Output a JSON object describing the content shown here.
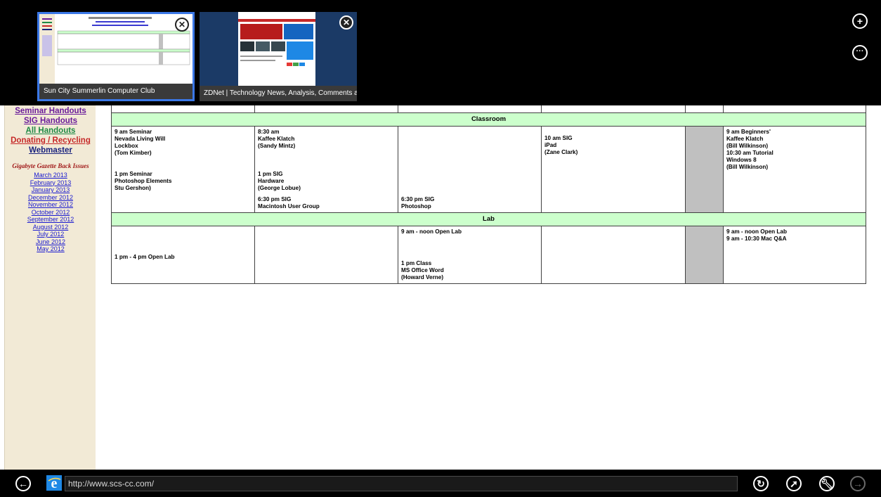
{
  "browser": {
    "tabs": [
      {
        "title": "Sun City Summerlin Computer Club",
        "active": true
      },
      {
        "title": "ZDNet | Technology News, Analysis, Comments a...",
        "active": false
      }
    ],
    "new_tab_icon": "plus-circle-icon",
    "tab_tools_icon": "ellipsis-circle-icon",
    "address": "http://www.scs-cc.com/",
    "appbar_icons": [
      "back-arrow-icon",
      "ie-logo-icon",
      "refresh-icon",
      "pin-icon",
      "wrench-icon",
      "forward-arrow-icon"
    ]
  },
  "sidebar": {
    "links": [
      {
        "label": "Seminar Handouts",
        "color": "#6a1b9a"
      },
      {
        "label": "SIG Handouts",
        "color": "#6a1b9a"
      },
      {
        "label": "All Handouts",
        "color": "#1e8a45"
      },
      {
        "label": "Donating / Recycling",
        "color": "#c62828"
      },
      {
        "label": "Webmaster",
        "color": "#1a237e"
      }
    ],
    "gazette_title": "Gigabyte Gazette Back Issues",
    "issues": [
      "March 2013",
      "February 2013",
      "January 2013",
      "December 2012",
      "November 2012",
      "October 2012",
      "September 2012",
      "August 2012",
      "July 2012",
      "June 2012",
      "May 2012"
    ]
  },
  "schedule": {
    "classroom_header": "Classroom",
    "lab_header": "Lab",
    "classroom": {
      "col1": "9 am Seminar\nNevada Living Will\nLockbox\n(Tom Kimber)\n\n\n1 pm Seminar\nPhotoshop Elements\nStu Gershon)",
      "col2_top": "8:30 am\nKaffee Klatch\n(Sandy Mintz)\n\n\n\n1 pm  SIG\nHardware\n(George Lobue)",
      "col2_bottom": "6:30 pm  SIG\nMacintosh User Group",
      "col3_bottom": "6:30 pm  SIG\nPhotoshop",
      "col4": "10 am  SIG\niPad\n(Zane Clark)",
      "col6": "9 am  Beginners'\nKaffee Klatch\n(Bill Wilkinson)\n10:30 am Tutorial\nWindows 8\n(Bill Wilkinson)"
    },
    "lab": {
      "col1": "1 pm - 4 pm  Open Lab",
      "col3_top": "9 am - noon Open Lab",
      "col3_bottom": "1 pm Class\nMS Office Word\n(Howard Verne)",
      "col6": "9 am - noon Open Lab\n9 am - 10:30 Mac Q&A"
    }
  },
  "colors": {
    "header_green": "#ccffcc",
    "gray_column": "#c0c0c0",
    "sidebar_bg": "#f2ead6",
    "active_tab_border": "#3b78e7"
  }
}
